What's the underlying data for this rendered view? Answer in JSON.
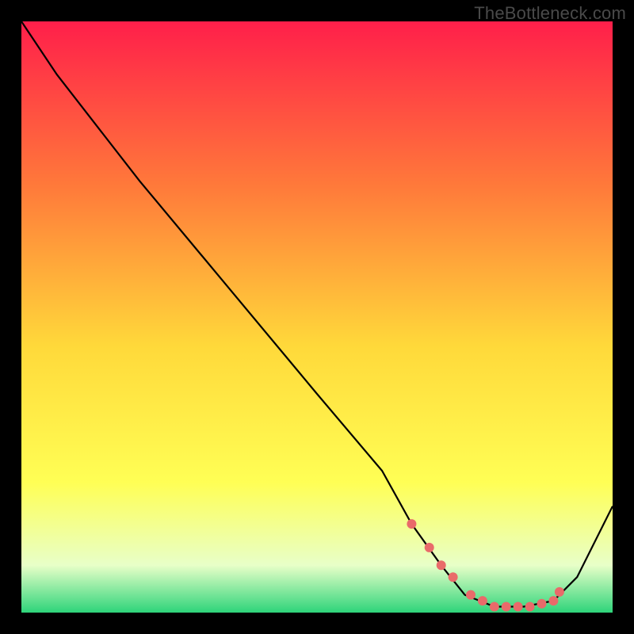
{
  "watermark": "TheBottleneck.com",
  "colors": {
    "accent_dot": "#e96a6a",
    "curve": "#000000",
    "bg_top": "#ff1f4a",
    "bg_mid1": "#ff7a3a",
    "bg_mid2": "#ffd93a",
    "bg_mid3": "#ffff55",
    "bg_mid4": "#e8ffc8",
    "bg_bottom": "#2ed47a"
  },
  "chart_data": {
    "type": "line",
    "title": "",
    "xlabel": "",
    "ylabel": "",
    "xlim": [
      0,
      100
    ],
    "ylim": [
      0,
      100
    ],
    "series": [
      {
        "name": "bottleneck-curve",
        "x": [
          0,
          6,
          20,
          35,
          50,
          61,
          66,
          71,
          75,
          80,
          85,
          90,
          94,
          100
        ],
        "y": [
          100,
          91,
          73,
          55,
          37,
          24,
          15,
          8,
          3,
          1,
          1,
          2,
          6,
          18
        ]
      }
    ],
    "highlight_points": {
      "name": "optimal-range-dots",
      "x": [
        66,
        69,
        71,
        73,
        76,
        78,
        80,
        82,
        84,
        86,
        88,
        90,
        91
      ],
      "y": [
        15,
        11,
        8,
        6,
        3,
        2,
        1,
        1,
        1,
        1,
        1.5,
        2,
        3.5
      ]
    }
  }
}
